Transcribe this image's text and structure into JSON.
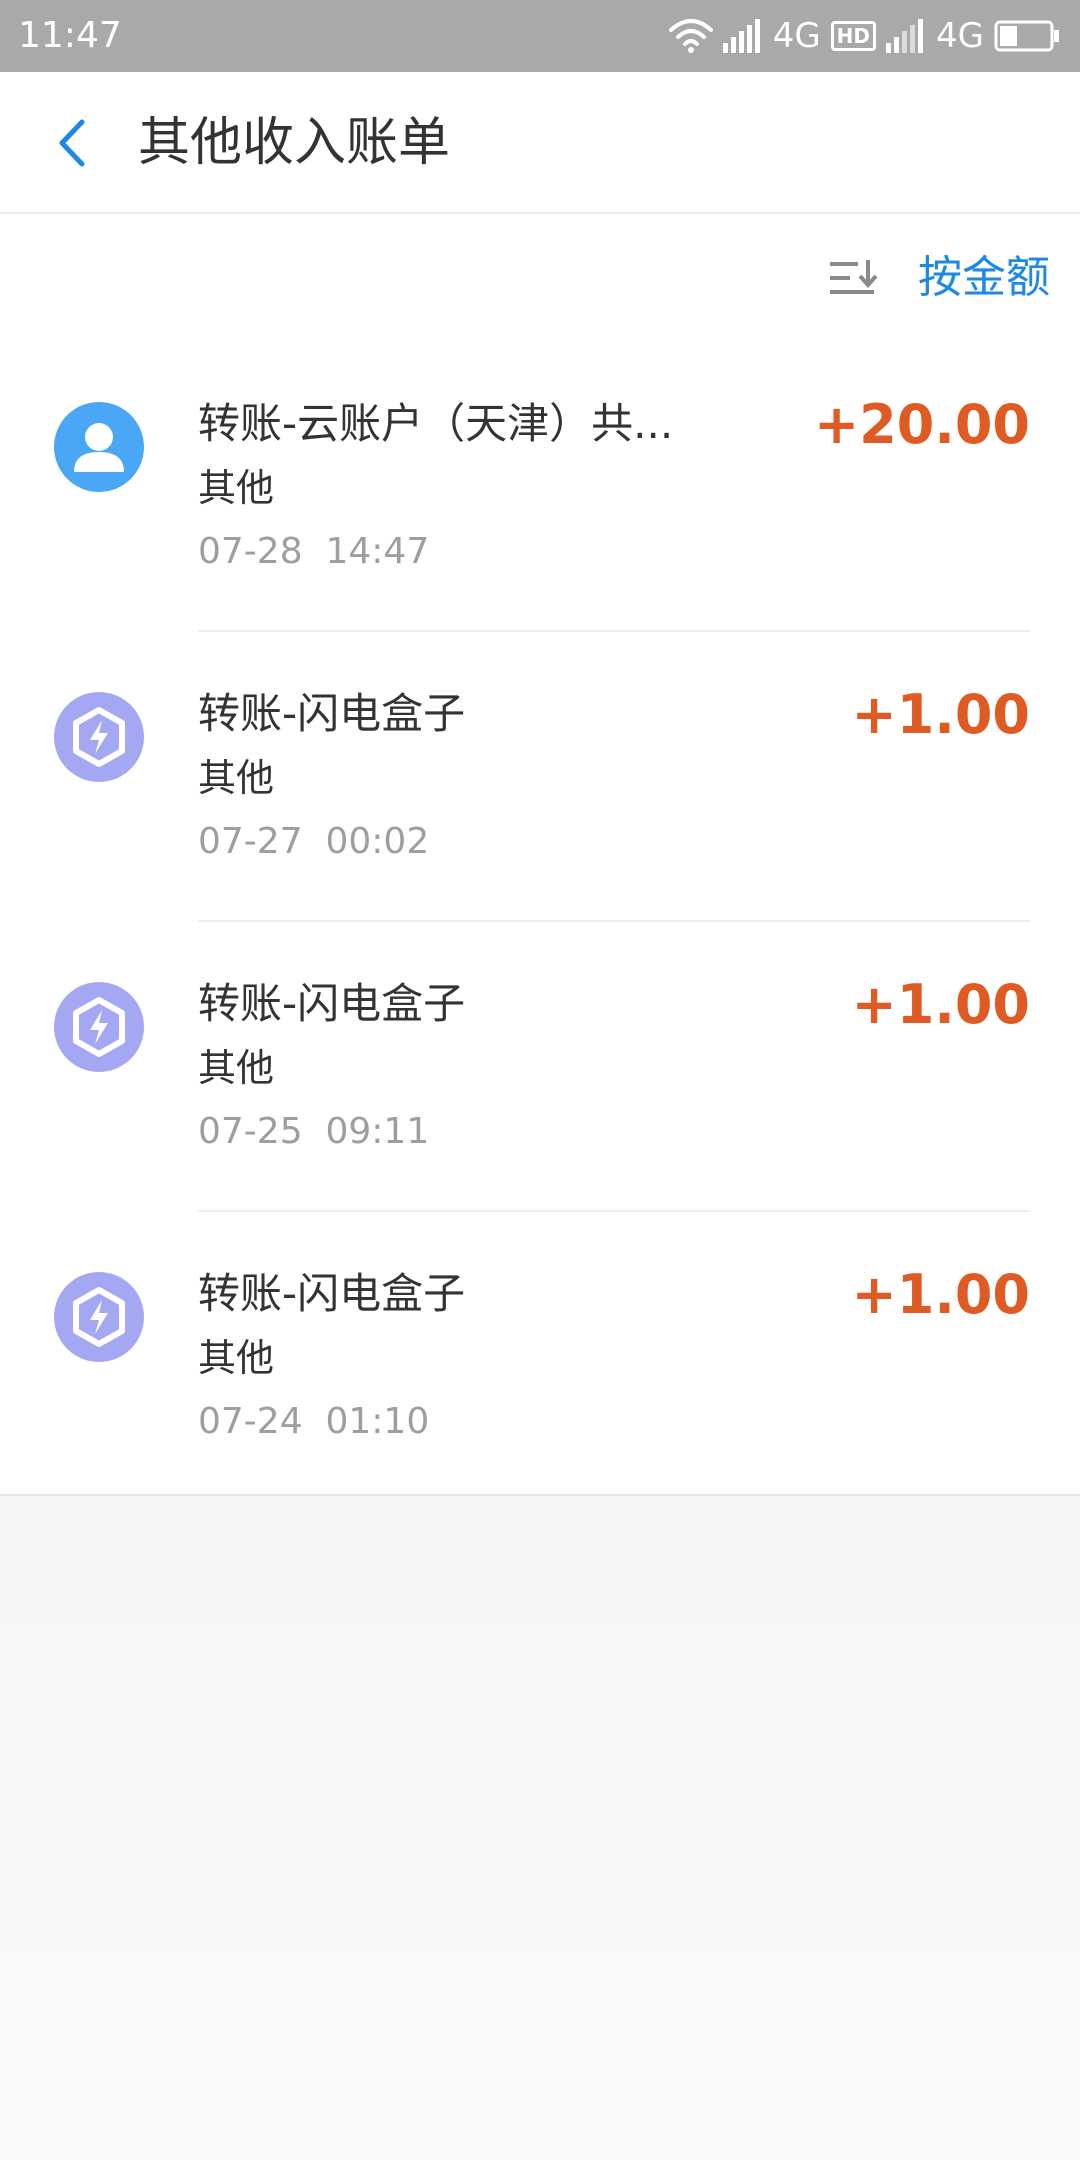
{
  "status_bar": {
    "time": "11:47",
    "network_1": "4G",
    "hd_badge": "HD",
    "network_2": "4G",
    "battery_level": 0.35
  },
  "header": {
    "title": "其他收入账单",
    "back_icon": "chevron-left-icon"
  },
  "sort": {
    "icon": "sort-icon",
    "label": "按金额"
  },
  "colors": {
    "accent": "#1e88e5",
    "amount": "#e05a24",
    "secondary_text": "#9e9e9e"
  },
  "transactions": [
    {
      "avatar": "user-icon",
      "title": "转账-云账户（天津）共...",
      "category": "其他",
      "datetime": "07-28  14:47",
      "amount": "+20.00"
    },
    {
      "avatar": "lightning-box-icon",
      "title": "转账-闪电盒子",
      "category": "其他",
      "datetime": "07-27  00:02",
      "amount": "+1.00"
    },
    {
      "avatar": "lightning-box-icon",
      "title": "转账-闪电盒子",
      "category": "其他",
      "datetime": "07-25  09:11",
      "amount": "+1.00"
    },
    {
      "avatar": "lightning-box-icon",
      "title": "转账-闪电盒子",
      "category": "其他",
      "datetime": "07-24  01:10",
      "amount": "+1.00"
    }
  ]
}
